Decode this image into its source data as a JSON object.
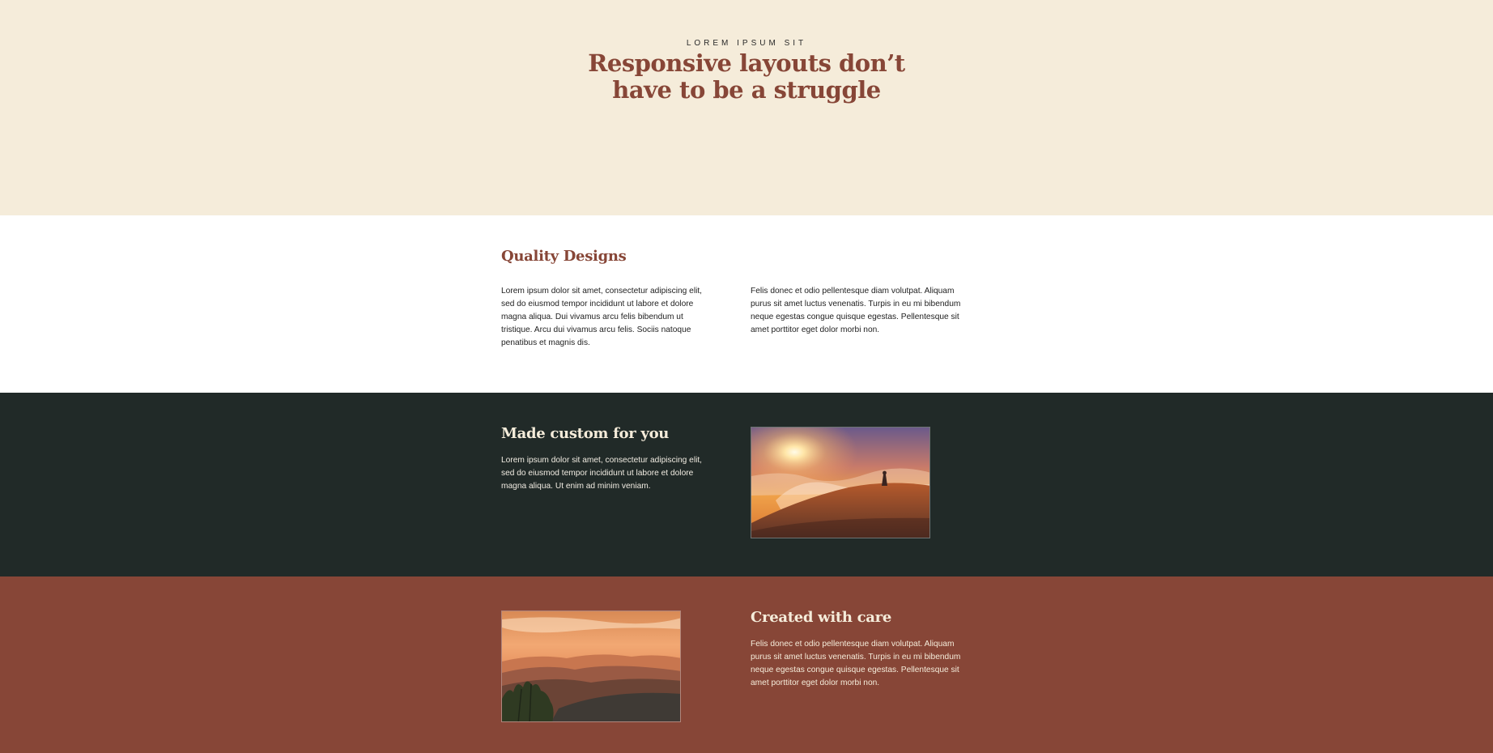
{
  "hero": {
    "eyebrow": "LOREM IPSUM SIT",
    "title_line1": "Responsive layouts don’t",
    "title_line2": "have to be a struggle",
    "background": "#f5ecda",
    "title_color": "#874637"
  },
  "quality": {
    "heading": "Quality Designs",
    "left_text": "Lorem ipsum dolor sit amet, consectetur adipiscing elit, sed do eiusmod tempor incididunt ut labore et dolore magna aliqua. Dui vivamus arcu felis bibendum ut tristique. Arcu dui vivamus arcu felis. Sociis natoque penatibus et magnis dis.",
    "right_text": "Felis donec et odio pellentesque diam volutpat. Aliquam purus sit amet luctus venenatis. Turpis in eu mi bibendum neque egestas congue quisque egestas. Pellentesque sit amet porttitor eget dolor morbi non."
  },
  "custom": {
    "heading": "Made custom for you",
    "text": "Lorem ipsum dolor sit amet, consectetur adipiscing elit, sed do eiusmod tempor incididunt ut labore et dolore magna aliqua. Ut enim ad minim veniam.",
    "image": "sunrise-mountain-hiker-photo",
    "background": "#212a28"
  },
  "care": {
    "heading": "Created with care",
    "text": "Felis donec et odio pellentesque diam volutpat. Aliquam purus sit amet luctus venenatis. Turpis in eu mi bibendum neque egestas congue quisque egestas. Pellentesque sit amet porttitor eget dolor morbi non.",
    "image": "sunset-mountain-ridges-photo",
    "background": "#874637"
  }
}
